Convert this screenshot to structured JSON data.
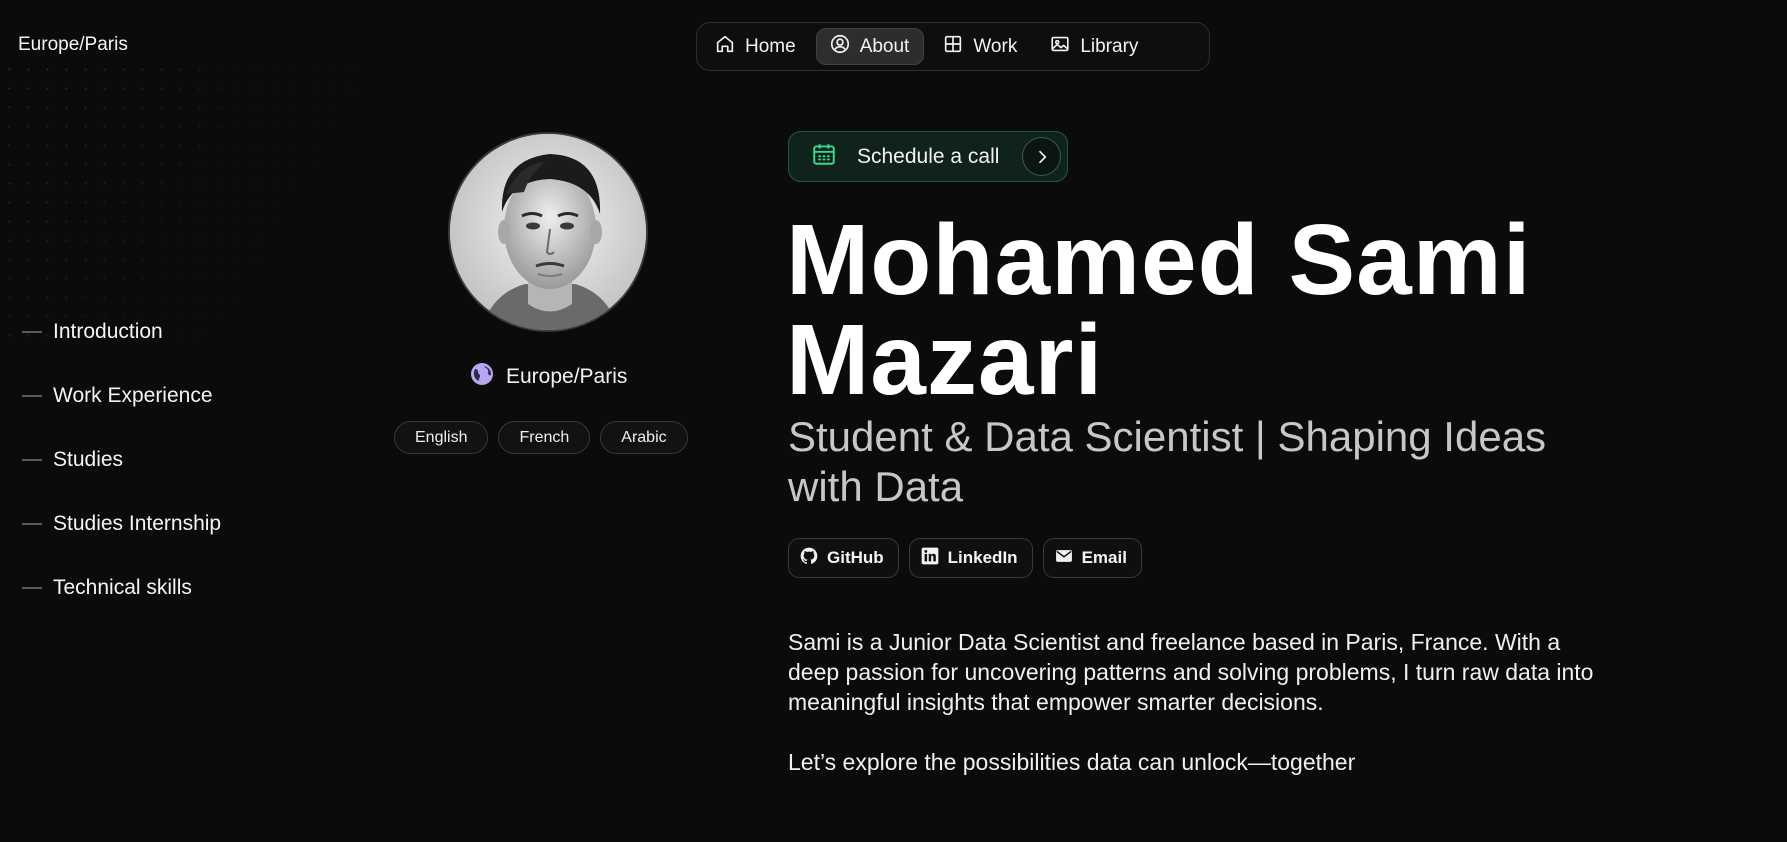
{
  "header": {
    "timezone": "Europe/Paris"
  },
  "nav": {
    "items": [
      {
        "label": "Home",
        "icon": "home-icon"
      },
      {
        "label": "About",
        "icon": "user-circle-icon",
        "active": true
      },
      {
        "label": "Work",
        "icon": "grid-icon"
      },
      {
        "label": "Library",
        "icon": "image-icon"
      }
    ]
  },
  "sidebar": {
    "items": [
      {
        "label": "Introduction"
      },
      {
        "label": "Work Experience"
      },
      {
        "label": "Studies"
      },
      {
        "label": "Studies Internship"
      },
      {
        "label": "Technical skills"
      }
    ]
  },
  "profile": {
    "location": "Europe/Paris",
    "languages": [
      "English",
      "French",
      "Arabic"
    ]
  },
  "hero": {
    "schedule_label": "Schedule a call",
    "name_line1": "Mohamed Sami",
    "name_line2": "Mazari",
    "subtitle": "Student & Data Scientist | Shaping Ideas with Data"
  },
  "socials": [
    {
      "label": "GitHub",
      "icon": "github-icon"
    },
    {
      "label": "LinkedIn",
      "icon": "linkedin-icon"
    },
    {
      "label": "Email",
      "icon": "envelope-icon"
    }
  ],
  "bio": {
    "paragraph1": "Sami is a Junior Data Scientist and freelance based in Paris, France. With a deep passion for uncovering patterns and solving problems, I turn raw data into meaningful insights that empower smarter decisions.",
    "paragraph2": "Let’s explore the possibilities data can unlock—together"
  },
  "colors": {
    "background": "#0b0b0c",
    "accent_green": "#3dd68c",
    "globe_purple": "#b9a6f0"
  }
}
